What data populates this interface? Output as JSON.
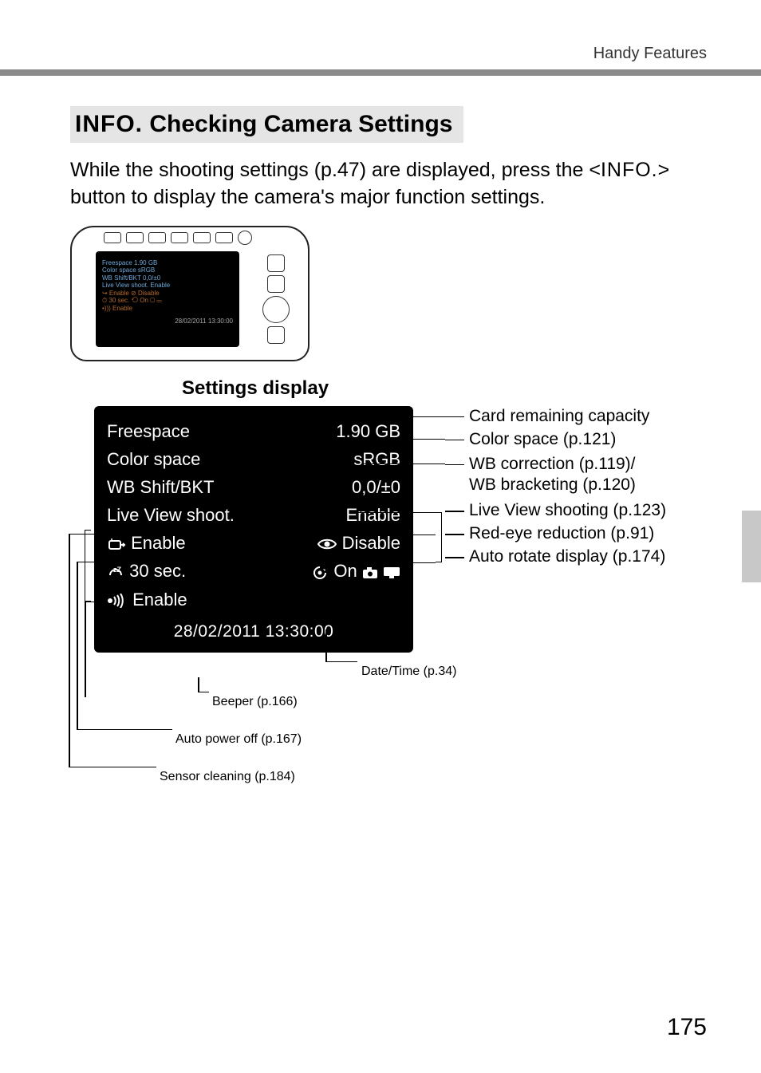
{
  "header": {
    "section": "Handy Features"
  },
  "heading": {
    "info_prefix": "INFO.",
    "title": "Checking Camera Settings"
  },
  "para": {
    "line1_a": "While the shooting settings (p.47) are displayed, press the <",
    "line1_b": "INFO.",
    "line1_c": ">",
    "line2": "button to display the camera's major function settings."
  },
  "sub_heading": "Settings display",
  "panel": {
    "rows": [
      {
        "label": "Freespace",
        "value": "1.90 GB"
      },
      {
        "label": "Color space",
        "value": "sRGB"
      },
      {
        "label": "WB Shift/BKT",
        "value": "0,0/±0"
      },
      {
        "label": "Live View shoot.",
        "value": "Enable"
      },
      {
        "label_icon": "sensor-clean",
        "label_text": "Enable",
        "value_icon": "redeye",
        "value_text": "Disable"
      },
      {
        "label_icon": "power-off",
        "label_text": "30 sec.",
        "value_icon": "rotate",
        "value_text": "On",
        "value_trailing_icons": true
      },
      {
        "label_icon": "beeper",
        "label_text": "Enable"
      }
    ],
    "datetime": "28/02/2011 13:30:00"
  },
  "callouts": {
    "right": [
      {
        "text": "Card remaining capacity"
      },
      {
        "text": "Color space (p.121)"
      },
      {
        "text_a": "WB correction (p.119)/",
        "text_b": "WB bracketing (p.120)"
      },
      {
        "text": "Live View shooting (p.123)"
      },
      {
        "text": "Red-eye reduction (p.91)"
      },
      {
        "text": "Auto rotate display (p.174)"
      }
    ],
    "bottom": {
      "datetime": "Date/Time (p.34)",
      "beeper": "Beeper (p.166)",
      "poweroff": "Auto power off (p.167)",
      "sensor": "Sensor cleaning (p.184)"
    }
  },
  "page_number": "175",
  "thumb": {
    "rows": [
      "Freespace            1.90 GB",
      "Color space           sRGB",
      "WB Shift/BKT        0,0/±0",
      "Live View shoot.   Enable"
    ],
    "accent_rows": [
      "↪ Enable     ⊘ Disable",
      "⏱ 30 sec.   ⟲ On ▢ ▭"
    ],
    "last_row": "•))) Enable",
    "dt": "28/02/2011 13:30:00"
  }
}
